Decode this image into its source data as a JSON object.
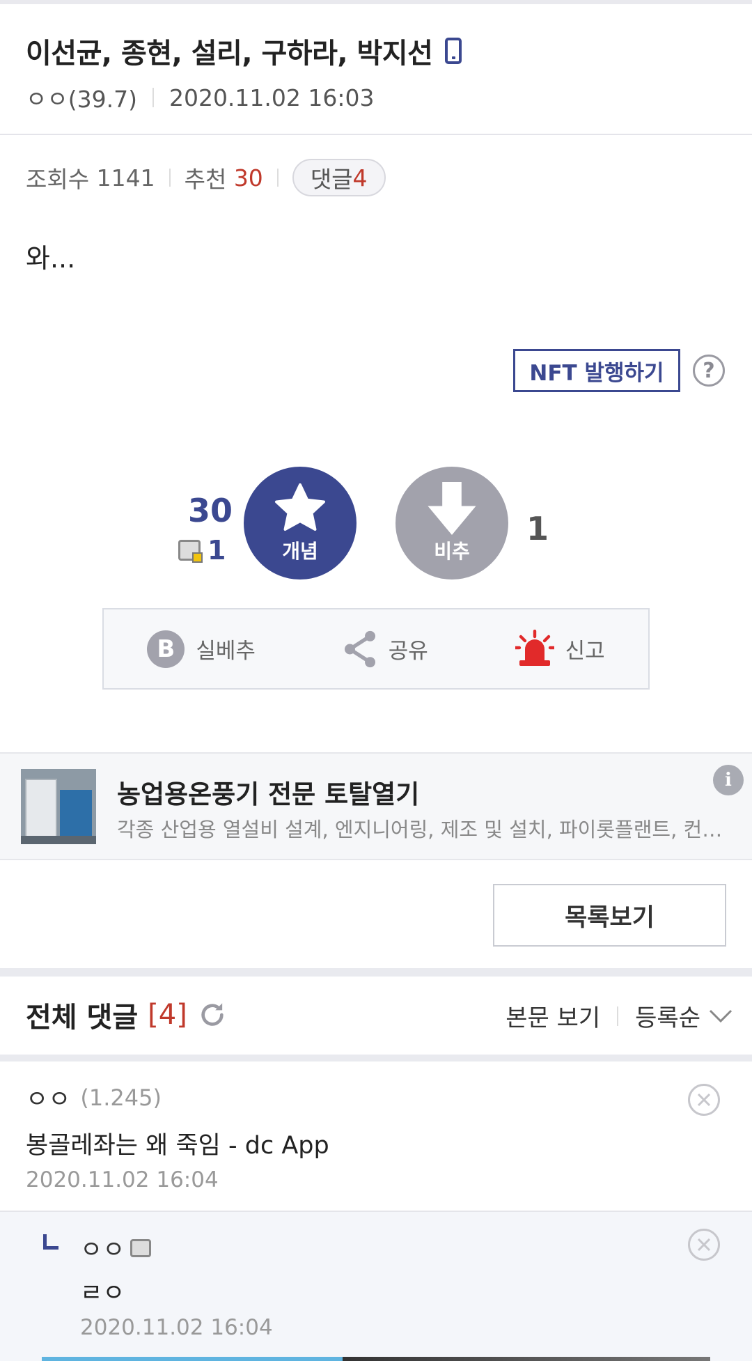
{
  "post": {
    "title": "이선균, 종현, 설리, 구하라, 박지선",
    "device_icon": "mobile-phone-icon",
    "author": "ㅇㅇ(39.7)",
    "date": "2020.11.02 16:03",
    "views_label": "조회수",
    "views": "1141",
    "recommend_label": "추천",
    "recommend": "30",
    "comment_label": "댓글",
    "comment_count": "4",
    "body": "와..."
  },
  "nft": {
    "button_label": "NFT 발행하기",
    "help_icon": "?"
  },
  "vote": {
    "up_count": "30",
    "fix_count": "1",
    "up_label": "개념",
    "down_label": "비추",
    "down_count": "1",
    "up_color": "#3b4890",
    "down_color": "#a2a2ac"
  },
  "actions": {
    "b_icon": "B",
    "b_label": "실베추",
    "share_label": "공유",
    "report_label": "신고"
  },
  "ad": {
    "title": "농업용온풍기 전문 토탈열기",
    "description": "각종 산업용 열설비 설계, 엔지니어링, 제조 및 설치, 파이롯플랜트, 컨설팅",
    "info_icon": "i"
  },
  "list_button": "목록보기",
  "comments_section": {
    "title": "전체 댓글",
    "count": "[4]",
    "view_body": "본문 보기",
    "sort": "등록순"
  },
  "comments": [
    {
      "nick": "ㅇㅇ",
      "ip": "(1.245)",
      "text": "봉골레좌는 왜 죽임 - dc App",
      "date": "2020.11.02 16:04"
    },
    {
      "nick": "ㅇㅇ",
      "text": "ㄹㅇ",
      "date": "2020.11.02 16:04"
    }
  ],
  "colors": {
    "accent": "#3b4890",
    "red": "#c0392b",
    "report_red": "#e12a2a"
  }
}
